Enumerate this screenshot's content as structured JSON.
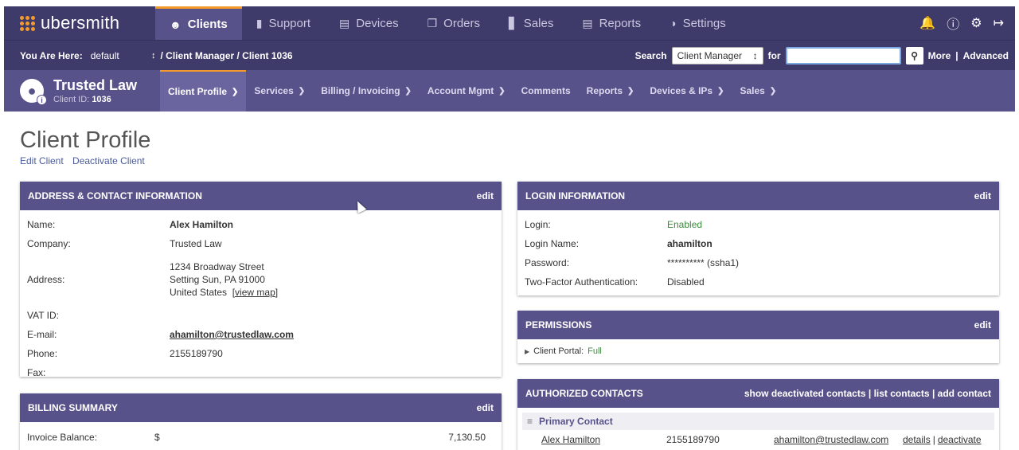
{
  "app": {
    "logo": "ubersmith"
  },
  "topnav": {
    "tabs": [
      {
        "label": "Clients",
        "icon": "user-circle-icon"
      },
      {
        "label": "Support",
        "icon": "ticket-icon"
      },
      {
        "label": "Devices",
        "icon": "server-icon"
      },
      {
        "label": "Orders",
        "icon": "orders-icon"
      },
      {
        "label": "Sales",
        "icon": "bar-chart-icon"
      },
      {
        "label": "Reports",
        "icon": "clipboard-icon"
      },
      {
        "label": "Settings",
        "icon": "gauge-icon"
      }
    ],
    "right_icons": [
      "bell-icon",
      "help-icon",
      "gear-icon",
      "logout-icon"
    ]
  },
  "breadcrumb": {
    "you_are_here": "You Are Here:",
    "context": "default",
    "path": "/  Client Manager  /  Client 1036"
  },
  "search": {
    "label": "Search",
    "scope": "Client Manager",
    "for_label": "for",
    "query": "",
    "more": "More",
    "separator": "|",
    "advanced": "Advanced"
  },
  "client": {
    "name": "Trusted Law",
    "id_label": "Client ID:",
    "id": "1036",
    "tabs": [
      "Client Profile",
      "Services",
      "Billing / Invoicing",
      "Account Mgmt",
      "Comments",
      "Reports",
      "Devices & IPs",
      "Sales"
    ],
    "tab_has_menu": [
      true,
      true,
      true,
      true,
      false,
      true,
      true,
      true
    ]
  },
  "page": {
    "title": "Client Profile",
    "links": [
      "Edit Client",
      "Deactivate Client"
    ]
  },
  "address_panel": {
    "title": "ADDRESS & CONTACT INFORMATION",
    "action": "edit",
    "rows": [
      {
        "label": "Name:",
        "value": "Alex Hamilton"
      },
      {
        "label": "Company:",
        "value": "Trusted Law"
      },
      {
        "label": "Address:",
        "line1": "1234 Broadway Street",
        "line2": "Setting Sun, PA 91000",
        "line3": "United States",
        "map_link": "[view map]"
      },
      {
        "label": "VAT ID:",
        "value": ""
      },
      {
        "label": "E-mail:",
        "value": "ahamilton@trustedlaw.com"
      },
      {
        "label": "Phone:",
        "value": "2155189790"
      },
      {
        "label": "Fax:",
        "value": ""
      }
    ]
  },
  "billing_panel": {
    "title": "BILLING SUMMARY",
    "action": "edit",
    "invoice_label": "Invoice Balance:",
    "currency": "$",
    "invoice_value": "7,130.50"
  },
  "login_panel": {
    "title": "LOGIN INFORMATION",
    "action": "edit",
    "rows": [
      {
        "label": "Login:",
        "value": "Enabled"
      },
      {
        "label": "Login Name:",
        "value": "ahamilton"
      },
      {
        "label": "Password:",
        "value": "********** (ssha1)"
      },
      {
        "label": "Two-Factor Authentication:",
        "value": "Disabled"
      }
    ]
  },
  "permissions_panel": {
    "title": "PERMISSIONS",
    "action": "edit",
    "portal_label": "Client Portal:",
    "portal_value": "Full"
  },
  "contacts_panel": {
    "title": "AUTHORIZED CONTACTS",
    "actions": [
      "show deactivated contacts",
      "list contacts",
      "add contact"
    ],
    "separator": "|",
    "group": "Primary Contact",
    "contact": {
      "name": "Alex Hamilton",
      "phone": "2155189790",
      "email": "ahamilton@trustedlaw.com",
      "details": "details",
      "deactivate": "deactivate"
    }
  },
  "colors": {
    "nav_bg": "#3e3a6a",
    "client_bar": "#57528a",
    "accent": "#f39a2b",
    "enabled": "#3c8a3c"
  }
}
